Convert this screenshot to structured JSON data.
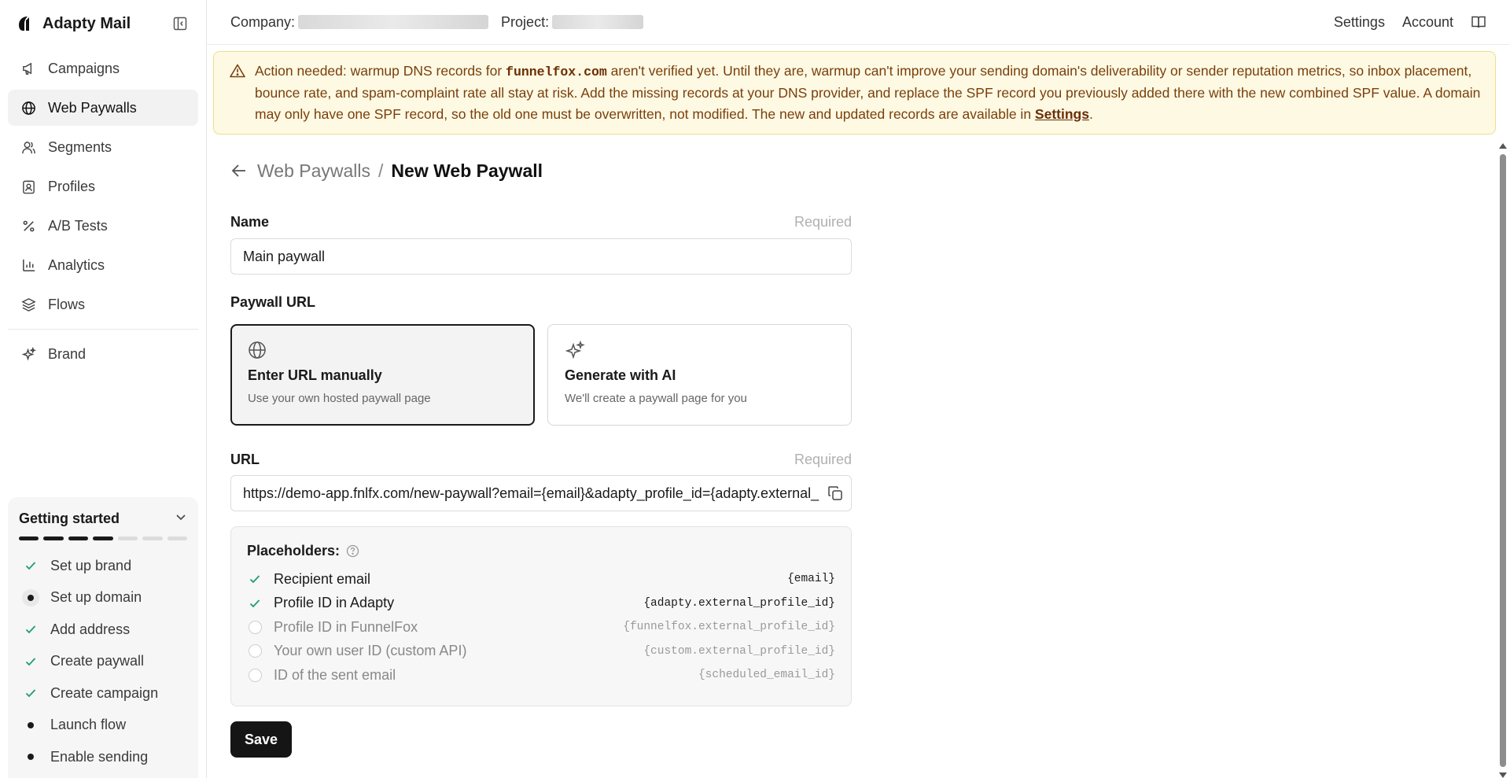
{
  "app": {
    "name": "Adapty Mail"
  },
  "sidebar": {
    "items": [
      {
        "label": "Campaigns",
        "icon": "megaphone-icon"
      },
      {
        "label": "Web Paywalls",
        "icon": "globe-icon",
        "active": true
      },
      {
        "label": "Segments",
        "icon": "users-icon"
      },
      {
        "label": "Profiles",
        "icon": "profile-card-icon"
      },
      {
        "label": "A/B Tests",
        "icon": "percent-icon"
      },
      {
        "label": "Analytics",
        "icon": "bar-chart-icon"
      },
      {
        "label": "Flows",
        "icon": "layers-icon"
      }
    ],
    "brand_item": {
      "label": "Brand",
      "icon": "sparkles-icon"
    }
  },
  "getting_started": {
    "title": "Getting started",
    "progress": {
      "done": 4,
      "total": 7
    },
    "items": [
      {
        "label": "Set up brand",
        "status": "done"
      },
      {
        "label": "Set up domain",
        "status": "current"
      },
      {
        "label": "Add address",
        "status": "done"
      },
      {
        "label": "Create paywall",
        "status": "done"
      },
      {
        "label": "Create campaign",
        "status": "done"
      },
      {
        "label": "Launch flow",
        "status": "todo"
      },
      {
        "label": "Enable sending",
        "status": "todo"
      }
    ]
  },
  "topbar": {
    "company_label": "Company:",
    "project_label": "Project:",
    "settings": "Settings",
    "account": "Account"
  },
  "alert": {
    "text_before": "Action needed: warmup DNS records for ",
    "domain": "funnelfox.com",
    "text_after": " aren't verified yet. Until they are, warmup can't improve your sending domain's deliverability or sender reputation metrics, so inbox placement, bounce rate, and spam-complaint rate all stay at risk. Add the missing records at your DNS provider, and replace the SPF record you previously added there with the new combined SPF value. A domain may only have one SPF record, so the old one must be overwritten, not modified. The new and updated records are available in ",
    "link": "Settings",
    "end": "."
  },
  "breadcrumb": {
    "parent": "Web Paywalls",
    "separator": "/",
    "current": "New Web Paywall"
  },
  "form": {
    "name_label": "Name",
    "required": "Required",
    "name_value": "Main paywall",
    "paywall_url_label": "Paywall URL",
    "options": [
      {
        "title": "Enter URL manually",
        "subtitle": "Use your own hosted paywall page",
        "icon": "globe-icon",
        "selected": true
      },
      {
        "title": "Generate with AI",
        "subtitle": "We'll create a paywall page for you",
        "icon": "sparkles-icon",
        "selected": false
      }
    ],
    "url_label": "URL",
    "url_value": "https://demo-app.fnlfx.com/new-paywall?email={email}&adapty_profile_id={adapty.external_",
    "placeholders_title": "Placeholders:",
    "placeholders": [
      {
        "label": "Recipient email",
        "code": "{email}",
        "checked": true
      },
      {
        "label": "Profile ID in Adapty",
        "code": "{adapty.external_profile_id}",
        "checked": true
      },
      {
        "label": "Profile ID in FunnelFox",
        "code": "{funnelfox.external_profile_id}",
        "checked": false
      },
      {
        "label": "Your own user ID (custom API)",
        "code": "{custom.external_profile_id}",
        "checked": false
      },
      {
        "label": "ID of the sent email",
        "code": "{scheduled_email_id}",
        "checked": false
      }
    ],
    "save": "Save"
  },
  "colors": {
    "alert_bg": "#fdf9e3",
    "alert_text": "#7a3f0c",
    "check_green": "#1f9d6b",
    "primary": "#151515"
  }
}
